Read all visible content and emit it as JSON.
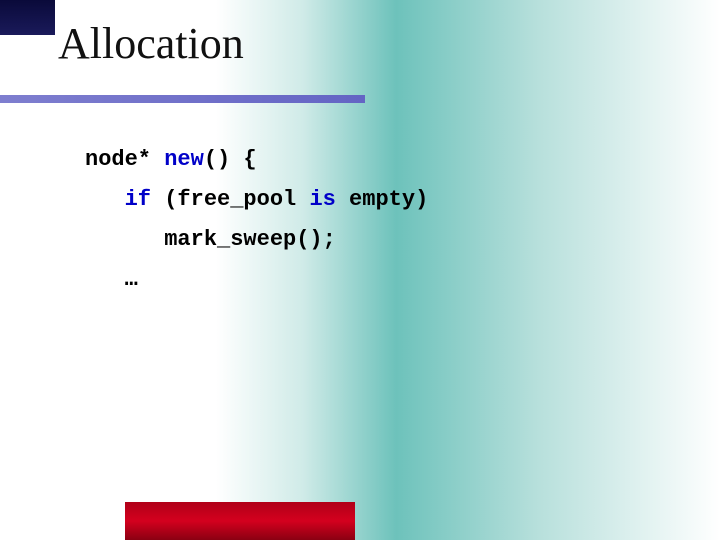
{
  "title": "Allocation",
  "code": {
    "l1a": "node* ",
    "l1b": "new",
    "l1c": "() {",
    "l2a": "   ",
    "l2b": "if",
    "l2c": " (free_pool ",
    "l2d": "is",
    "l2e": " empty)",
    "l3": "      mark_sweep();",
    "l4": "   …"
  }
}
